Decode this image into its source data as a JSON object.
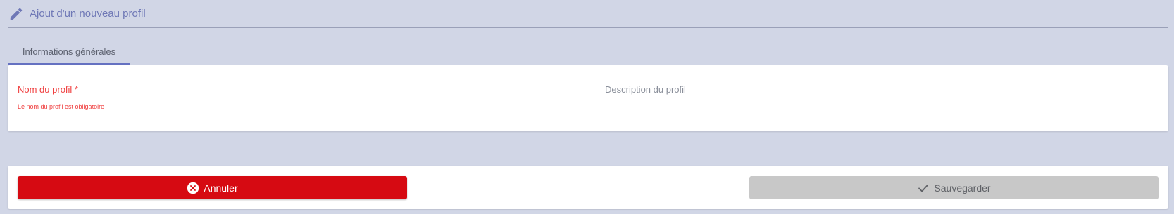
{
  "header": {
    "title": "Ajout d'un nouveau profil",
    "icon": "pencil-icon"
  },
  "tabs": [
    {
      "label": "Informations générales",
      "active": true
    }
  ],
  "form": {
    "name_field": {
      "label": "Nom du profil *",
      "value": "",
      "error": "Le nom du profil est obligatoire"
    },
    "description_field": {
      "label": "Description du profil",
      "value": ""
    }
  },
  "actions": {
    "cancel_label": "Annuler",
    "save_label": "Sauvegarder"
  },
  "colors": {
    "background": "#d1d6e6",
    "accent": "#6571c1",
    "error": "#f04040",
    "cancel": "#d60a12",
    "disabled": "#c8c8c8"
  }
}
